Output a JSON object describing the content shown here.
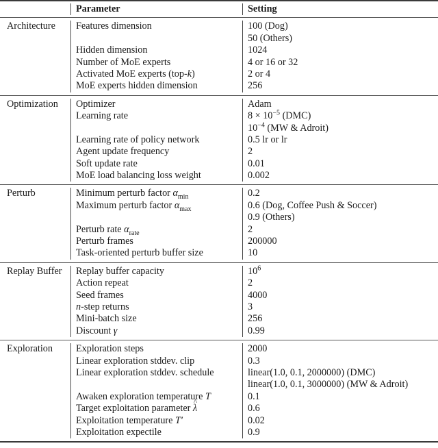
{
  "header": {
    "col1": "",
    "col2": "Parameter",
    "col3": "Setting"
  },
  "groups": [
    {
      "name": "Architecture",
      "rows": [
        {
          "param": "Features dimension",
          "settings": [
            "100 (Dog)",
            "50 (Others)"
          ]
        },
        {
          "param": "Hidden dimension",
          "settings": [
            "1024"
          ]
        },
        {
          "param": "Number of MoE experts",
          "settings": [
            "4 or 16 or 32"
          ]
        },
        {
          "param": "Activated MoE experts (top-k)",
          "settings": [
            "2 or 4"
          ]
        },
        {
          "param": "MoE experts hidden dimension",
          "settings": [
            "256"
          ]
        }
      ]
    },
    {
      "name": "Optimization",
      "rows": [
        {
          "param": "Optimizer",
          "settings": [
            "Adam"
          ]
        },
        {
          "param": "Learning rate",
          "settings": [
            "8 × 10^-5 (DMC)",
            "10^-4 (MW & Adroit)"
          ]
        },
        {
          "param": "Learning rate of policy network",
          "settings": [
            "0.5 lr or lr"
          ]
        },
        {
          "param": "Agent update frequency",
          "settings": [
            "2"
          ]
        },
        {
          "param": "Soft update rate",
          "settings": [
            "0.01"
          ]
        },
        {
          "param": "MoE load balancing loss weight",
          "settings": [
            "0.002"
          ]
        }
      ]
    },
    {
      "name": "Perturb",
      "rows": [
        {
          "param": "Minimum perturb factor α_min",
          "settings": [
            "0.2"
          ]
        },
        {
          "param": "Maximum perturb factor α_max",
          "settings": [
            "0.6 (Dog, Coffee Push & Soccer)",
            "0.9 (Others)"
          ]
        },
        {
          "param": "Perturb rate α_rate",
          "settings": [
            "2"
          ]
        },
        {
          "param": "Perturb frames",
          "settings": [
            "200000"
          ]
        },
        {
          "param": "Task-oriented perturb buffer size",
          "settings": [
            "10"
          ]
        }
      ]
    },
    {
      "name": "Replay Buffer",
      "rows": [
        {
          "param": "Replay buffer capacity",
          "settings": [
            "10^6"
          ]
        },
        {
          "param": "Action repeat",
          "settings": [
            "2"
          ]
        },
        {
          "param": "Seed frames",
          "settings": [
            "4000"
          ]
        },
        {
          "param": "n-step returns",
          "settings": [
            "3"
          ]
        },
        {
          "param": "Mini-batch size",
          "settings": [
            "256"
          ]
        },
        {
          "param": "Discount γ",
          "settings": [
            "0.99"
          ]
        }
      ]
    },
    {
      "name": "Exploration",
      "rows": [
        {
          "param": "Exploration steps",
          "settings": [
            "2000"
          ]
        },
        {
          "param": "Linear exploration stddev. clip",
          "settings": [
            "0.3"
          ]
        },
        {
          "param": "Linear exploration stddev. schedule",
          "settings": [
            "linear(1.0, 0.1, 2000000) (DMC)",
            "linear(1.0, 0.1, 3000000) (MW & Adroit)"
          ]
        },
        {
          "param": "Awaken exploration temperature T",
          "settings": [
            "0.1"
          ]
        },
        {
          "param": "Target exploitation parameter λ̂",
          "settings": [
            "0.6"
          ]
        },
        {
          "param": "Exploitation temperature T′",
          "settings": [
            "0.02"
          ]
        },
        {
          "param": "Exploitation expectile",
          "settings": [
            "0.9"
          ]
        }
      ]
    }
  ],
  "math": {
    "k": "k",
    "alpha": "α",
    "min": "min",
    "max": "max",
    "rate": "rate",
    "n": "n",
    "gamma": "γ",
    "lambda": "λ",
    "T": "T",
    "Tprime": "T′",
    "times": "×",
    "ten": "10",
    "exp_m5": "−5",
    "exp_m4": "−4",
    "exp_6": "6",
    "lr_dmc_prefix": "8",
    "lr_dmc_suffix": " (DMC)",
    "lr_mw_suffix": " (MW & Adroit)"
  },
  "text": {
    "top_k_prefix": "Activated MoE experts (top-",
    "top_k_suffix": ")",
    "alpha_min_prefix": "Minimum perturb factor ",
    "alpha_max_prefix": "Maximum perturb factor ",
    "alpha_rate_prefix": "Perturb rate ",
    "nstep_suffix": "-step returns",
    "discount_prefix": "Discount ",
    "awaken_prefix": "Awaken exploration temperature ",
    "target_prefix": "Target exploitation parameter ",
    "exploit_temp_prefix": "Exploitation temperature "
  }
}
